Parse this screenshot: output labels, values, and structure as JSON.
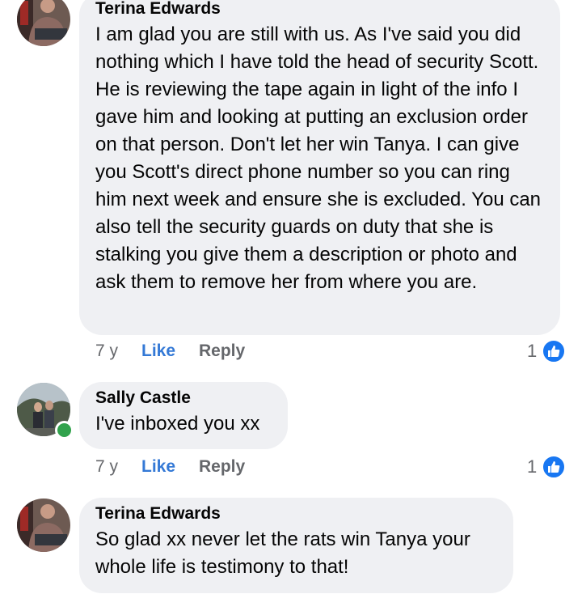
{
  "comments": [
    {
      "author": "Terina Edwards",
      "text": "I am glad you are still with us. As I've said you did nothing which I have told the head of security Scott. He is reviewing the tape again in light of the info I gave him and looking at putting an exclusion order on that person. Don't let her win Tanya. I can give you Scott's direct phone number so you can ring him next week and ensure she is excluded. You can also tell the security guards on duty that she is stalking you give them a description or photo and ask them to remove her from where you are.",
      "time": "7 y",
      "like_label": "Like",
      "reply_label": "Reply",
      "reaction_count": "1",
      "online": false
    },
    {
      "author": "Sally Castle",
      "text": "I've inboxed you xx",
      "time": "7 y",
      "like_label": "Like",
      "reply_label": "Reply",
      "reaction_count": "1",
      "online": true
    },
    {
      "author": "Terina Edwards",
      "text": "So glad xx never let the rats win Tanya your whole life is testimony to that!",
      "online": false
    }
  ],
  "colors": {
    "bubble": "#eff0f3",
    "like_blue": "#3479d6",
    "meta_gray": "#65676b",
    "online_green": "#31a24c"
  },
  "icons": {
    "reaction": "thumbs-up-icon",
    "presence": "online-status-dot"
  }
}
